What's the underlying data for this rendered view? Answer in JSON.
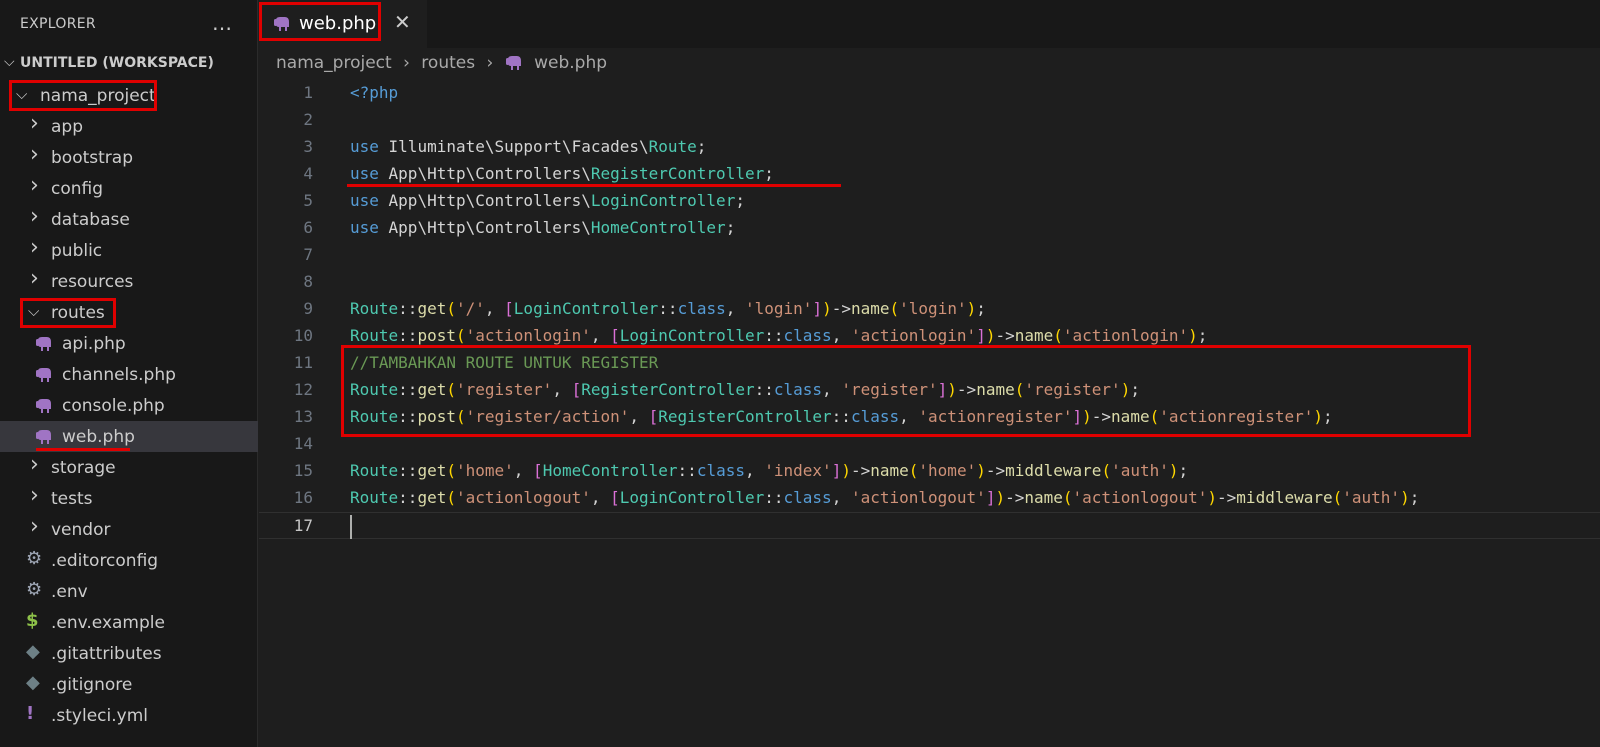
{
  "sidebar": {
    "title": "EXPLORER",
    "more_icon": "…",
    "workspace": "UNTITLED (WORKSPACE)",
    "project": "nama_project",
    "folders_top": [
      "app",
      "bootstrap",
      "config",
      "database",
      "public",
      "resources"
    ],
    "routes_folder": "routes",
    "route_files": [
      "api.php",
      "channels.php",
      "console.php",
      "web.php"
    ],
    "folders_bottom": [
      "storage",
      "tests",
      "vendor"
    ],
    "root_files": [
      ".editorconfig",
      ".env",
      ".env.example",
      ".gitattributes",
      ".gitignore",
      ".styleci.yml"
    ],
    "selected_file": "web.php",
    "colors": {
      "php_icon": "#a074c4",
      "gear_icon": "#9da5b4",
      "dollar_icon": "#8dc149",
      "git_icon": "#6d8086",
      "exclaim_icon": "#a074c4"
    }
  },
  "tab": {
    "label": "web.php",
    "close_icon": "✕"
  },
  "breadcrumb": [
    "nama_project",
    "routes",
    "web.php"
  ],
  "editor": {
    "active_line": 17,
    "line_numbers": [
      "1",
      "2",
      "3",
      "4",
      "5",
      "6",
      "7",
      "8",
      "9",
      "10",
      "11",
      "12",
      "13",
      "14",
      "15",
      "16",
      "17"
    ],
    "lines": [
      [
        [
          "kw",
          "<?php"
        ]
      ],
      [],
      [
        [
          "kw",
          "use"
        ],
        [
          "pl",
          " Illuminate\\Support\\Facades\\"
        ],
        [
          "cls",
          "Route"
        ],
        [
          "pl",
          ";"
        ]
      ],
      [
        [
          "kw",
          "use"
        ],
        [
          "pl",
          " App\\Http\\Controllers\\"
        ],
        [
          "cls",
          "RegisterController"
        ],
        [
          "pl",
          ";"
        ]
      ],
      [
        [
          "kw",
          "use"
        ],
        [
          "pl",
          " App\\Http\\Controllers\\"
        ],
        [
          "cls",
          "LoginController"
        ],
        [
          "pl",
          ";"
        ]
      ],
      [
        [
          "kw",
          "use"
        ],
        [
          "pl",
          " App\\Http\\Controllers\\"
        ],
        [
          "cls",
          "HomeController"
        ],
        [
          "pl",
          ";"
        ]
      ],
      [],
      [],
      [
        [
          "cls",
          "Route"
        ],
        [
          "pl",
          "::"
        ],
        [
          "fn",
          "get"
        ],
        [
          "p1",
          "("
        ],
        [
          "str",
          "'/'"
        ],
        [
          "pl",
          ", "
        ],
        [
          "p2",
          "["
        ],
        [
          "cls",
          "LoginController"
        ],
        [
          "pl",
          "::"
        ],
        [
          "cl",
          "class"
        ],
        [
          "pl",
          ", "
        ],
        [
          "str",
          "'login'"
        ],
        [
          "p2",
          "]"
        ],
        [
          "p1",
          ")"
        ],
        [
          "pl",
          "->"
        ],
        [
          "fn",
          "name"
        ],
        [
          "p1",
          "("
        ],
        [
          "str",
          "'login'"
        ],
        [
          "p1",
          ")"
        ],
        [
          "pl",
          ";"
        ]
      ],
      [
        [
          "cls",
          "Route"
        ],
        [
          "pl",
          "::"
        ],
        [
          "fn",
          "post"
        ],
        [
          "p1",
          "("
        ],
        [
          "str",
          "'actionlogin'"
        ],
        [
          "pl",
          ", "
        ],
        [
          "p2",
          "["
        ],
        [
          "cls",
          "LoginController"
        ],
        [
          "pl",
          "::"
        ],
        [
          "cl",
          "class"
        ],
        [
          "pl",
          ", "
        ],
        [
          "str",
          "'actionlogin'"
        ],
        [
          "p2",
          "]"
        ],
        [
          "p1",
          ")"
        ],
        [
          "pl",
          "->"
        ],
        [
          "fn",
          "name"
        ],
        [
          "p1",
          "("
        ],
        [
          "str",
          "'actionlogin'"
        ],
        [
          "p1",
          ")"
        ],
        [
          "pl",
          ";"
        ]
      ],
      [
        [
          "cm",
          "//TAMBAHKAN ROUTE UNTUK REGISTER"
        ]
      ],
      [
        [
          "cls",
          "Route"
        ],
        [
          "pl",
          "::"
        ],
        [
          "fn",
          "get"
        ],
        [
          "p1",
          "("
        ],
        [
          "str",
          "'register'"
        ],
        [
          "pl",
          ", "
        ],
        [
          "p2",
          "["
        ],
        [
          "cls",
          "RegisterController"
        ],
        [
          "pl",
          "::"
        ],
        [
          "cl",
          "class"
        ],
        [
          "pl",
          ", "
        ],
        [
          "str",
          "'register'"
        ],
        [
          "p2",
          "]"
        ],
        [
          "p1",
          ")"
        ],
        [
          "pl",
          "->"
        ],
        [
          "fn",
          "name"
        ],
        [
          "p1",
          "("
        ],
        [
          "str",
          "'register'"
        ],
        [
          "p1",
          ")"
        ],
        [
          "pl",
          ";"
        ]
      ],
      [
        [
          "cls",
          "Route"
        ],
        [
          "pl",
          "::"
        ],
        [
          "fn",
          "post"
        ],
        [
          "p1",
          "("
        ],
        [
          "str",
          "'register/action'"
        ],
        [
          "pl",
          ", "
        ],
        [
          "p2",
          "["
        ],
        [
          "cls",
          "RegisterController"
        ],
        [
          "pl",
          "::"
        ],
        [
          "cl",
          "class"
        ],
        [
          "pl",
          ", "
        ],
        [
          "str",
          "'actionregister'"
        ],
        [
          "p2",
          "]"
        ],
        [
          "p1",
          ")"
        ],
        [
          "pl",
          "->"
        ],
        [
          "fn",
          "name"
        ],
        [
          "p1",
          "("
        ],
        [
          "str",
          "'actionregister'"
        ],
        [
          "p1",
          ")"
        ],
        [
          "pl",
          ";"
        ]
      ],
      [],
      [
        [
          "cls",
          "Route"
        ],
        [
          "pl",
          "::"
        ],
        [
          "fn",
          "get"
        ],
        [
          "p1",
          "("
        ],
        [
          "str",
          "'home'"
        ],
        [
          "pl",
          ", "
        ],
        [
          "p2",
          "["
        ],
        [
          "cls",
          "HomeController"
        ],
        [
          "pl",
          "::"
        ],
        [
          "cl",
          "class"
        ],
        [
          "pl",
          ", "
        ],
        [
          "str",
          "'index'"
        ],
        [
          "p2",
          "]"
        ],
        [
          "p1",
          ")"
        ],
        [
          "pl",
          "->"
        ],
        [
          "fn",
          "name"
        ],
        [
          "p1",
          "("
        ],
        [
          "str",
          "'home'"
        ],
        [
          "p1",
          ")"
        ],
        [
          "pl",
          "->"
        ],
        [
          "fn",
          "middleware"
        ],
        [
          "p1",
          "("
        ],
        [
          "str",
          "'auth'"
        ],
        [
          "p1",
          ")"
        ],
        [
          "pl",
          ";"
        ]
      ],
      [
        [
          "cls",
          "Route"
        ],
        [
          "pl",
          "::"
        ],
        [
          "fn",
          "get"
        ],
        [
          "p1",
          "("
        ],
        [
          "str",
          "'actionlogout'"
        ],
        [
          "pl",
          ", "
        ],
        [
          "p2",
          "["
        ],
        [
          "cls",
          "LoginController"
        ],
        [
          "pl",
          "::"
        ],
        [
          "cl",
          "class"
        ],
        [
          "pl",
          ", "
        ],
        [
          "str",
          "'actionlogout'"
        ],
        [
          "p2",
          "]"
        ],
        [
          "p1",
          ")"
        ],
        [
          "pl",
          "->"
        ],
        [
          "fn",
          "name"
        ],
        [
          "p1",
          "("
        ],
        [
          "str",
          "'actionlogout'"
        ],
        [
          "p1",
          ")"
        ],
        [
          "pl",
          "->"
        ],
        [
          "fn",
          "middleware"
        ],
        [
          "p1",
          "("
        ],
        [
          "str",
          "'auth'"
        ],
        [
          "p1",
          ")"
        ],
        [
          "pl",
          ";"
        ]
      ],
      []
    ]
  }
}
